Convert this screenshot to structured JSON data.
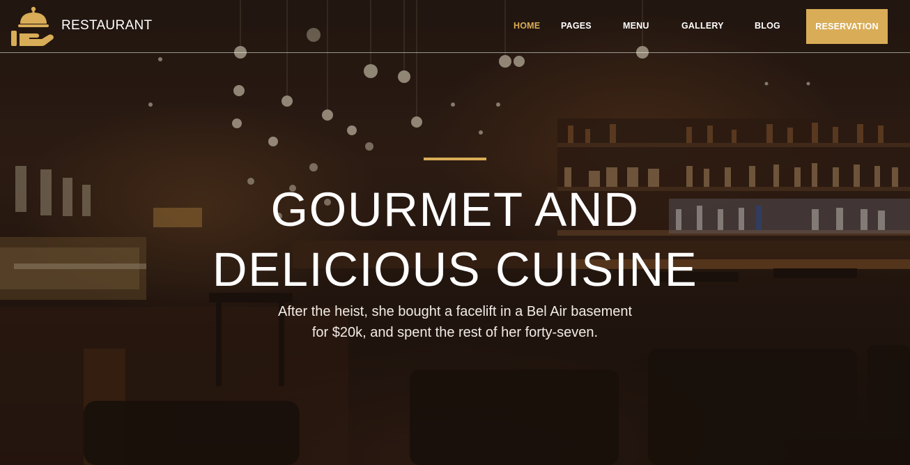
{
  "brand": {
    "name": "RESTAURANT",
    "icon": "cloche-hand-icon",
    "accent_color": "#d9ad57"
  },
  "nav": {
    "items": [
      {
        "label": "HOME",
        "active": true
      },
      {
        "label": "PAGES",
        "active": false
      },
      {
        "label": "MENU",
        "active": false
      },
      {
        "label": "GALLERY",
        "active": false
      },
      {
        "label": "BLOG",
        "active": false
      }
    ],
    "cta_label": "RESERVATION"
  },
  "hero": {
    "title_line1": "GOURMET AND",
    "title_line2": "DELICIOUS CUISINE",
    "subtitle_line1": "After the heist, she bought a facelift in a Bel Air basement",
    "subtitle_line2": "for $20k, and spent the rest of her forty-seven.",
    "background": "restaurant-bar-interior-photo"
  }
}
